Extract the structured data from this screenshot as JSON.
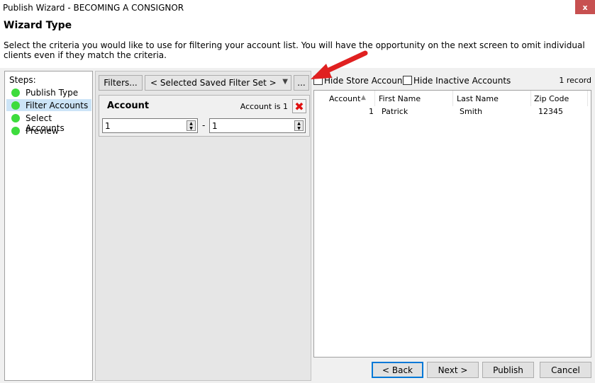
{
  "window": {
    "title": "Publish Wizard - BECOMING A CONSIGNOR",
    "close_label": "x"
  },
  "header": {
    "heading": "Wizard Type",
    "description": "Select the criteria you would like to use for filtering your account list.  You will have the opportunity on the next screen to omit individual clients even if they match the criteria."
  },
  "steps": {
    "label": "Steps:",
    "items": [
      {
        "label": "Publish Type",
        "active": false
      },
      {
        "label": "Filter Accounts",
        "active": true
      },
      {
        "label": "Select Accounts",
        "active": false
      },
      {
        "label": "Preview",
        "active": false
      }
    ],
    "dot_color": "#3ddc3d"
  },
  "filter": {
    "filters_button": "Filters...",
    "saved_set": "< Selected Saved Filter Set >",
    "more_button": "...",
    "box_title": "Account",
    "box_desc": "Account is 1",
    "from_value": "1",
    "dash": "-",
    "to_value": "1"
  },
  "options": {
    "hide_store": "Hide Store Accounts",
    "hide_inactive": "Hide Inactive Accounts",
    "hide_store_checked": false,
    "hide_inactive_checked": false,
    "record_count": "1 record"
  },
  "grid": {
    "columns": [
      "Account",
      "First Name",
      "Last Name",
      "Zip Code"
    ],
    "rows": [
      [
        "1",
        "Patrick",
        "Smith",
        "12345"
      ]
    ]
  },
  "buttons": {
    "back": "< Back",
    "next": "Next >",
    "publish": "Publish",
    "cancel": "Cancel"
  },
  "colors": {
    "annotation_arrow": "#e02020",
    "selection": "#cce4f7",
    "focus": "#0078d7"
  }
}
